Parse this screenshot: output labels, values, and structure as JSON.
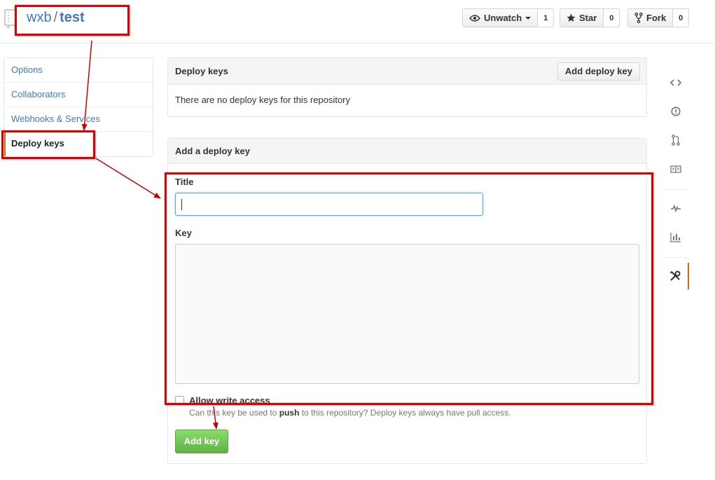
{
  "repo": {
    "owner": "wxb",
    "separator": "/",
    "name": "test"
  },
  "actions": {
    "unwatch": {
      "label": "Unwatch",
      "count": "1",
      "icon": "eye-icon"
    },
    "star": {
      "label": "Star",
      "count": "0",
      "icon": "star-icon"
    },
    "fork": {
      "label": "Fork",
      "count": "0",
      "icon": "fork-icon"
    }
  },
  "settings_menu": [
    {
      "label": "Options",
      "selected": false
    },
    {
      "label": "Collaborators",
      "selected": false
    },
    {
      "label": "Webhooks & Services",
      "selected": false
    },
    {
      "label": "Deploy keys",
      "selected": true
    }
  ],
  "deploy_keys": {
    "heading": "Deploy keys",
    "add_button": "Add deploy key",
    "empty_message": "There are no deploy keys for this repository"
  },
  "add_form": {
    "heading": "Add a deploy key",
    "title_label": "Title",
    "title_value": "",
    "key_label": "Key",
    "key_value": "",
    "write_access_label": "Allow write access",
    "write_access_checked": false,
    "note_prefix": "Can this key be used to ",
    "note_bold": "push",
    "note_suffix": " to this repository? Deploy keys always have pull access.",
    "submit_label": "Add key"
  },
  "repo_nav_icons": [
    "code-icon",
    "issues-icon",
    "pull-request-icon",
    "wiki-icon",
    "pulse-icon",
    "graphs-icon",
    "settings-tools-icon"
  ],
  "colors": {
    "link": "#4078c0",
    "accent": "#d26911",
    "primary_button": "#60b044",
    "annotation": "#dd0000"
  }
}
